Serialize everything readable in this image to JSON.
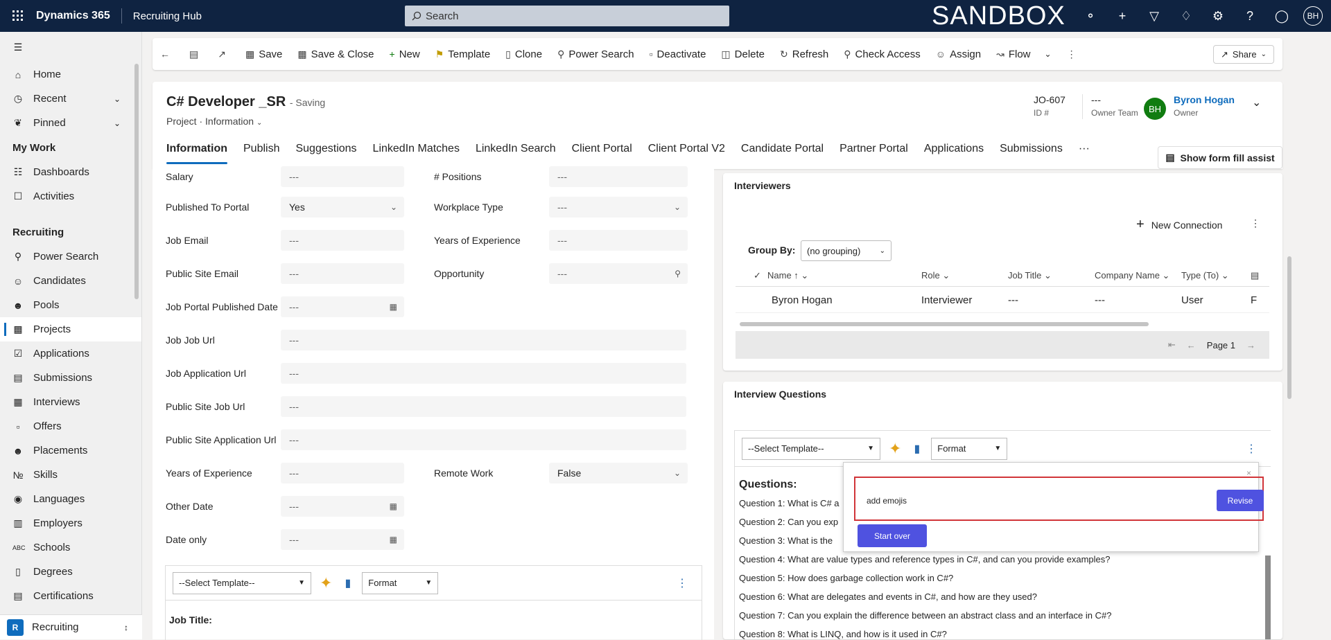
{
  "topbar": {
    "brand": "Dynamics 365",
    "app_name": "Recruiting Hub",
    "search_placeholder": "Search",
    "environment": "SANDBOX",
    "user_initials": "BH"
  },
  "sidebar": {
    "home": "Home",
    "recent": "Recent",
    "pinned": "Pinned",
    "my_work_header": "My Work",
    "my_work": [
      "Dashboards",
      "Activities"
    ],
    "recruiting_header": "Recruiting",
    "recruiting": [
      "Power Search",
      "Candidates",
      "Pools",
      "Projects",
      "Applications",
      "Submissions",
      "Interviews",
      "Offers",
      "Placements",
      "Skills",
      "Languages",
      "Employers",
      "Schools",
      "Degrees",
      "Certifications"
    ],
    "area_letter": "R",
    "area": "Recruiting"
  },
  "commands": {
    "save": "Save",
    "save_close": "Save & Close",
    "new": "New",
    "template": "Template",
    "clone": "Clone",
    "power_search": "Power Search",
    "deactivate": "Deactivate",
    "delete": "Delete",
    "refresh": "Refresh",
    "check_access": "Check Access",
    "assign": "Assign",
    "flow": "Flow",
    "share": "Share"
  },
  "record": {
    "title": "C# Developer _SR",
    "status": "- Saving",
    "entity": "Project",
    "form": "Information",
    "id_value": "JO-607",
    "id_label": "ID #",
    "owner_team_value": "---",
    "owner_team_label": "Owner Team",
    "owner_initials": "BH",
    "owner_name": "Byron Hogan",
    "owner_label": "Owner"
  },
  "tabs": [
    "Information",
    "Publish",
    "Suggestions",
    "LinkedIn Matches",
    "LinkedIn Search",
    "Client Portal",
    "Client Portal V2",
    "Candidate Portal",
    "Partner Portal",
    "Applications",
    "Submissions",
    "···"
  ],
  "form_fill_assist": "Show form fill assist",
  "fields": {
    "salary_label": "Salary",
    "salary_value": "---",
    "positions_label": "# Positions",
    "positions_value": "---",
    "published_label": "Published To Portal",
    "published_value": "Yes",
    "workplace_label": "Workplace Type",
    "workplace_value": "---",
    "job_email_label": "Job Email",
    "job_email_value": "---",
    "years_exp_label": "Years of Experience",
    "years_exp_value": "---",
    "public_email_label": "Public Site Email",
    "public_email_value": "---",
    "opportunity_label": "Opportunity",
    "opportunity_value": "---",
    "portal_date_label": "Job Portal Published Date",
    "portal_date_value": "---",
    "job_url_label": "Job Job Url",
    "job_url_value": "---",
    "job_app_url_label": "Job Application Url",
    "job_app_url_value": "---",
    "public_job_url_label": "Public Site Job Url",
    "public_job_url_value": "---",
    "public_app_url_label": "Public Site Application Url",
    "public_app_url_value": "---",
    "years_exp2_label": "Years of Experience",
    "years_exp2_value": "---",
    "remote_label": "Remote Work",
    "remote_value": "False",
    "other_date_label": "Other Date",
    "other_date_value": "---",
    "date_only_label": "Date only",
    "date_only_value": "---"
  },
  "left_editor": {
    "template_select": "--Select Template--",
    "format_select": "Format",
    "content_heading": "Job Title:"
  },
  "interviewers": {
    "title": "Interviewers",
    "new_connection": "New Connection",
    "group_by_label": "Group By:",
    "group_by_value": "(no grouping)",
    "columns": [
      "Name",
      "Role",
      "Job Title",
      "Company Name",
      "Type (To)"
    ],
    "row": {
      "name": "Byron Hogan",
      "role": "Interviewer",
      "job_title": "---",
      "company": "---",
      "type": "User",
      "extra": "F"
    },
    "page": "Page 1"
  },
  "interview_questions": {
    "title": "Interview Questions",
    "template_select": "--Select Template--",
    "format_select": "Format",
    "heading": "Questions:",
    "questions": [
      "Question 1: What is C# a",
      "Question 2: Can you exp",
      "Question 3: What is the",
      "Question 4: What are value types and reference types in C#, and can you provide examples?",
      "Question 5: How does garbage collection work in C#?",
      "Question 6: What are delegates and events in C#, and how are they used?",
      "Question 7: Can you explain the difference between an abstract class and an interface in C#?",
      "Question 8: What is LINQ, and how is it used in C#?"
    ]
  },
  "popup": {
    "input_value": "add emojis",
    "revise": "Revise",
    "start_over": "Start over",
    "close": "×"
  }
}
